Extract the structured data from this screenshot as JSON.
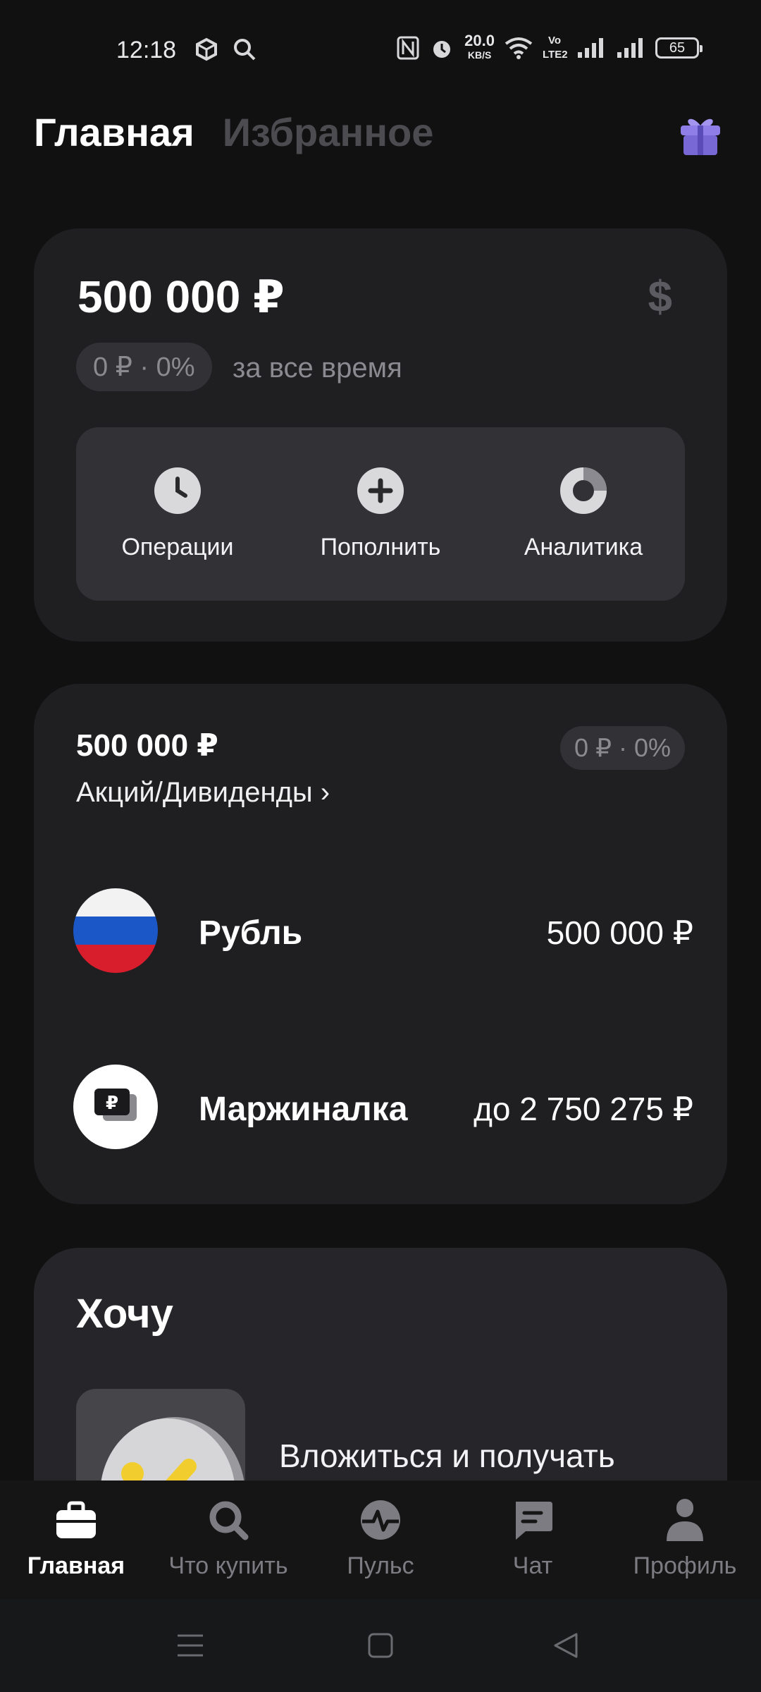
{
  "status_bar": {
    "time": "12:18",
    "net_speed": "20.0",
    "net_unit": "KB/S",
    "volte": "Vo LTE2",
    "battery": "65"
  },
  "header": {
    "tab_main": "Главная",
    "tab_favorites": "Избранное"
  },
  "balance_card": {
    "total": "500 000 ₽",
    "change_chip": "0 ₽ · 0%",
    "period": "за все время",
    "currency_symbol": "$",
    "actions": [
      "Операции",
      "Пополнить",
      "Аналитика"
    ]
  },
  "account_card": {
    "sum": "500 000 ₽",
    "change_chip": "0 ₽ · 0%",
    "account_link": "Акций/Дивиденды ›",
    "rows": [
      {
        "name": "Рубль",
        "amount": "500 000 ₽"
      },
      {
        "name": "Маржиналка",
        "amount": "до 2 750 275 ₽"
      }
    ]
  },
  "want_card": {
    "title": "Хочу",
    "promo_text": "Вложиться и получать"
  },
  "bottom_nav": [
    "Главная",
    "Что купить",
    "Пульс",
    "Чат",
    "Профиль"
  ],
  "colors": {
    "background": "#111112",
    "card": "#1f1f22",
    "accent_gift": "#8f7ee8",
    "flag_white": "#f2f2f2",
    "flag_blue": "#1c57c8",
    "flag_red": "#d81d2c"
  }
}
